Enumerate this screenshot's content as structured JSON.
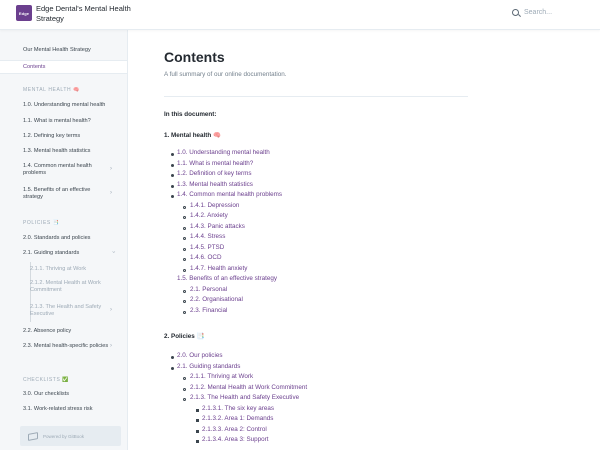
{
  "header": {
    "logo_text": "Edge",
    "app_title": "Edge Dental's Mental Health Strategy",
    "search_placeholder": "Search..."
  },
  "sidebar": {
    "top_items": [
      {
        "label": "Our Mental Health Strategy"
      },
      {
        "label": "Contents"
      }
    ],
    "sections": [
      {
        "title": "MENTAL HEALTH 🧠"
      },
      {
        "title": "POLICIES 📑"
      },
      {
        "title": "CHECKLISTS ✅"
      }
    ],
    "items": [
      {
        "label": "1.0. Understanding mental health"
      },
      {
        "label": "1.1. What is mental health?"
      },
      {
        "label": "1.2. Defining key terms"
      },
      {
        "label": "1.3. Mental health statistics"
      },
      {
        "label": "1.4. Common mental health problems"
      },
      {
        "label": "1.5. Benefits of an effective strategy"
      },
      {
        "label": "2.0. Standards and policies"
      },
      {
        "label": "2.1. Guiding standards"
      },
      {
        "label": "2.1.1. Thriving at Work"
      },
      {
        "label": "2.1.2. Mental Health at Work Commitment"
      },
      {
        "label": "2.1.3. The Health and Safety Executive"
      },
      {
        "label": "2.2. Absence policy"
      },
      {
        "label": "2.3. Mental health-specific policies"
      },
      {
        "label": "3.0. Our checklists"
      },
      {
        "label": "3.1. Work-related stress risk"
      }
    ],
    "powered_by": "Powered by GitBook"
  },
  "main": {
    "title": "Contents",
    "description": "A full summary of our online documentation.",
    "in_this_document": "In this document:",
    "section1_title": "1. Mental health 🧠",
    "section2_title": "2. Policies 📑",
    "list1": [
      "1.0. Understanding mental health",
      "1.1. What is mental health?",
      "1.2. Definition of key terms",
      "1.3. Mental health statistics",
      "1.4. Common mental health problems"
    ],
    "list1_sub": [
      "1.4.1. Depression",
      "1.4.2. Anxiety",
      "1.4.3. Panic attacks",
      "1.4.4. Stress",
      "1.4.5. PTSD",
      "1.4.6. OCD",
      "1.4.7. Health anxiety"
    ],
    "list1_b": "1.5. Benefits of an effective strategy",
    "list1_b_sub": [
      "2.1. Personal",
      "2.2. Organisational",
      "2.3. Financial"
    ],
    "list2": [
      "2.0. Our policies",
      "2.1. Guiding standards"
    ],
    "list2_sub": [
      "2.1.1. Thriving at Work",
      "2.1.2. Mental Health at Work Commitment",
      "2.1.3. The Health and Safety Executive"
    ],
    "list2_subsub": [
      "2.1.3.1. The six key areas",
      "2.1.3.2. Area 1: Demands",
      "2.1.3.3. Area 2: Control",
      "2.1.3.4. Area 3: Support"
    ]
  },
  "colors": {
    "accent": "#6b3f8e",
    "sidebar_bg": "#f5f7f9",
    "text": "#242a31",
    "muted": "#9daab6"
  }
}
